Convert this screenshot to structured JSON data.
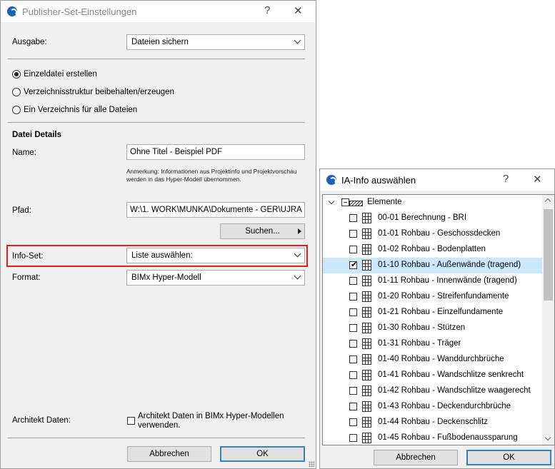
{
  "left_dialog": {
    "title": "Publisher-Set-Einstellungen",
    "help": "?",
    "close": "✕",
    "ausgabe_label": "Ausgabe:",
    "ausgabe_value": "Dateien sichern",
    "radio_options": [
      "Einzeldatei erstellen",
      "Verzeichnisstruktur beibehalten/erzeugen",
      "Ein Verzeichnis für alle Dateien"
    ],
    "radio_selected": 0,
    "details_heading": "Datei Details",
    "name_label": "Name:",
    "name_value": "Ohne Titel - Beispiel PDF",
    "note_line1": "Anmerkung: Informationen aus Projektinfo und Projektvorschau",
    "note_line2": "werden in das Hyper-Modell übernommen.",
    "pfad_label": "Pfad:",
    "pfad_value": "W:\\1. WORK\\MUNKA\\Dokumente - GER\\UJRA",
    "suchen_label": "Suchen...",
    "infoset_label": "Info-Set:",
    "infoset_value": "Liste auswählen:",
    "format_label": "Format:",
    "format_value": "BIMx Hyper-Modell",
    "architekt_label": "Architekt Daten:",
    "architekt_check_line1": "Architekt Daten in BIMx Hyper-Modellen",
    "architekt_check_line2": "verwenden.",
    "cancel": "Abbrechen",
    "ok": "OK"
  },
  "right_dialog": {
    "title": "IA-Info auswählen",
    "help": "?",
    "close": "✕",
    "root_label": "Elemente",
    "items": [
      {
        "label": "00-01 Berechnung - BRI",
        "checked": false
      },
      {
        "label": "01-01 Rohbau - Geschossdecken",
        "checked": false
      },
      {
        "label": "01-02 Rohbau - Bodenplatten",
        "checked": false
      },
      {
        "label": "01-10 Rohbau - Außenwände (tragend)",
        "checked": true
      },
      {
        "label": "01-11 Rohbau - Innenwände (tragend)",
        "checked": false
      },
      {
        "label": "01-20 Rohbau - Streifenfundamente",
        "checked": false
      },
      {
        "label": "01-21 Rohbau - Einzelfundamente",
        "checked": false
      },
      {
        "label": "01-30 Rohbau - Stützen",
        "checked": false
      },
      {
        "label": "01-31 Rohbau - Träger",
        "checked": false
      },
      {
        "label": "01-40 Rohbau - Wanddurchbrüche",
        "checked": false
      },
      {
        "label": "01-41 Rohbau - Wandschlitze senkrecht",
        "checked": false
      },
      {
        "label": "01-42 Rohbau - Wandschlitze waagerecht",
        "checked": false
      },
      {
        "label": "01-43 Rohbau - Deckendurchbrüche",
        "checked": false
      },
      {
        "label": "01-44 Rohbau - Deckenschlitz",
        "checked": false
      },
      {
        "label": "01-45 Rohbau - Fußbodenaussparung",
        "checked": false
      }
    ],
    "cancel": "Abbrechen",
    "ok": "OK"
  },
  "colors": {
    "highlight": "#e02020",
    "selection": "#cce8ff",
    "default_button_border": "#3c7fb1"
  }
}
